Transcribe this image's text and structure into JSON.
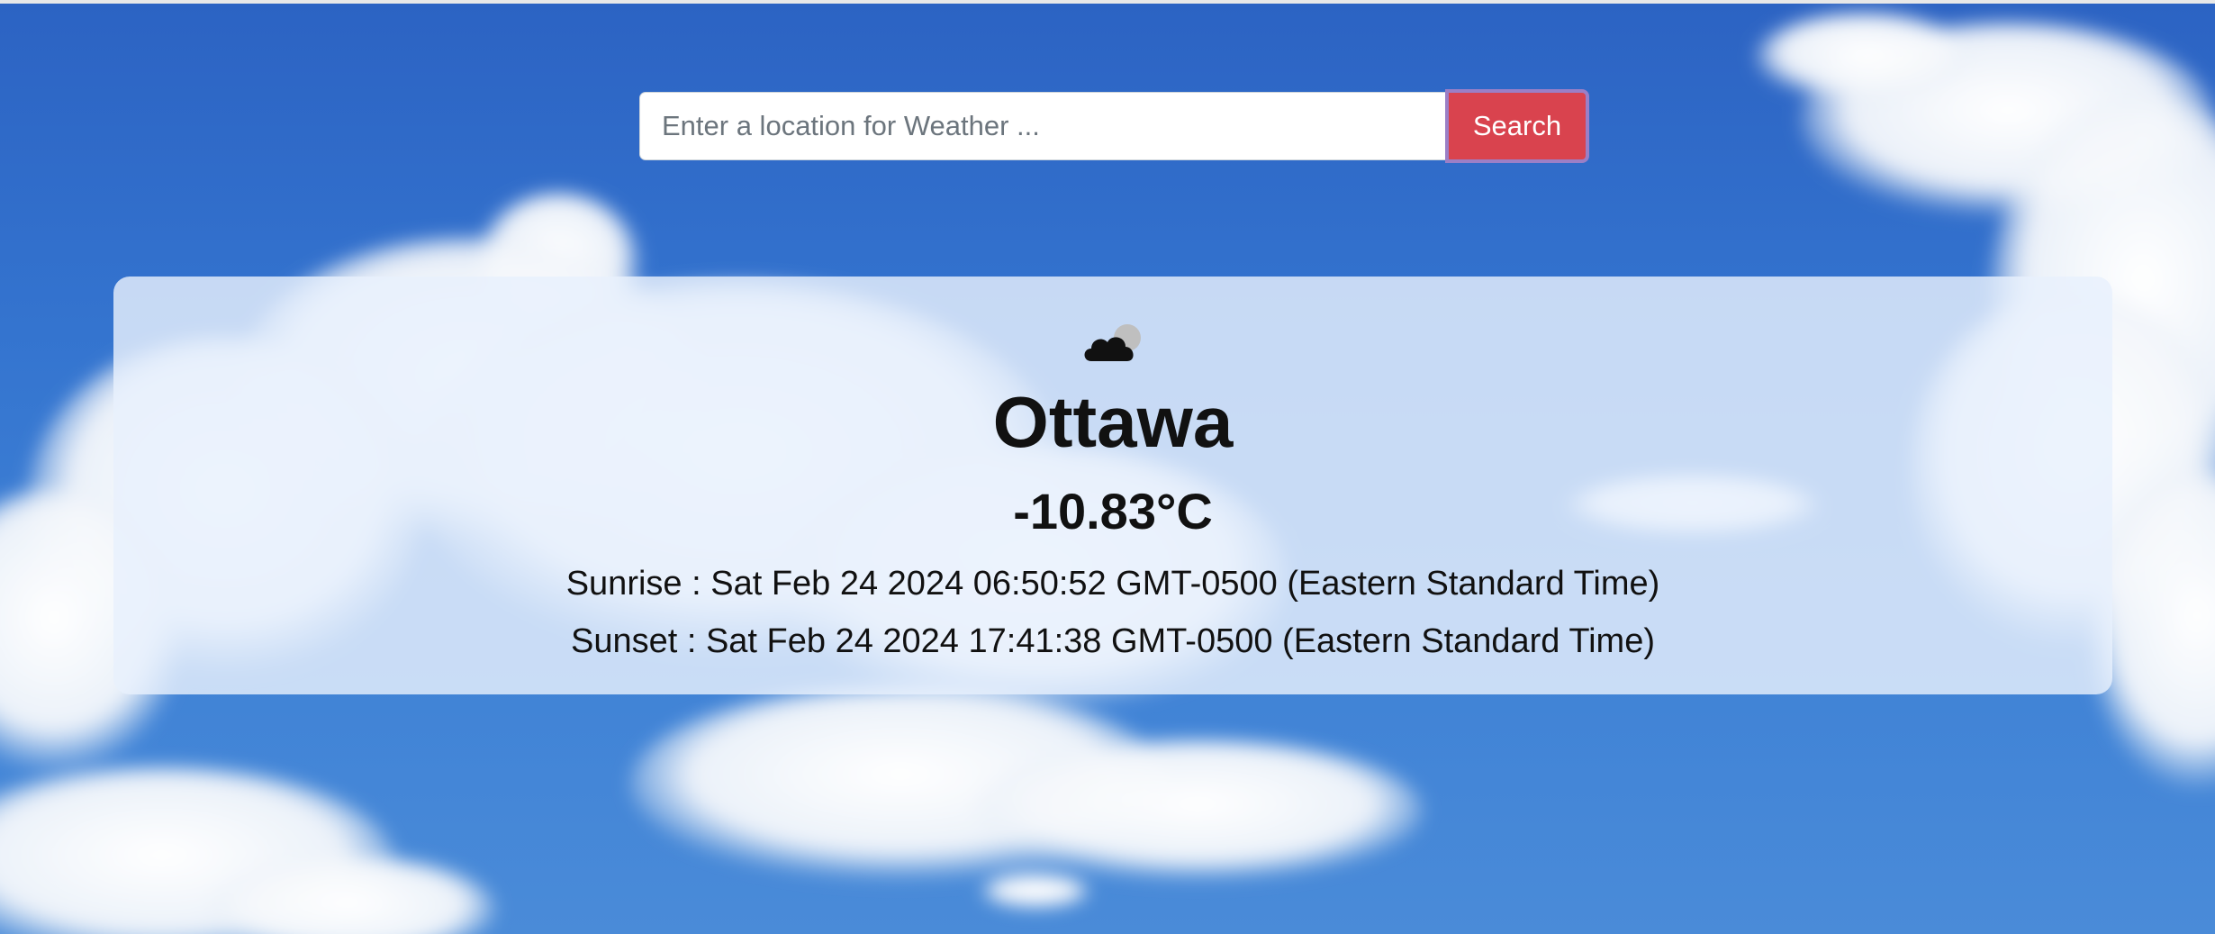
{
  "search": {
    "placeholder": "Enter a location for Weather ...",
    "value": "",
    "button_label": "Search"
  },
  "weather": {
    "icon": "cloud-moon-icon",
    "city": "Ottawa",
    "temperature": "-10.83°C",
    "sunrise": "Sunrise : Sat Feb 24 2024 06:50:52 GMT-0500 (Eastern Standard Time)",
    "sunset": "Sunset : Sat Feb 24 2024 17:41:38 GMT-0500 (Eastern Standard Time)"
  },
  "colors": {
    "sky": "#3474cf",
    "button": "#d9434e",
    "card": "#e8f0fc"
  }
}
